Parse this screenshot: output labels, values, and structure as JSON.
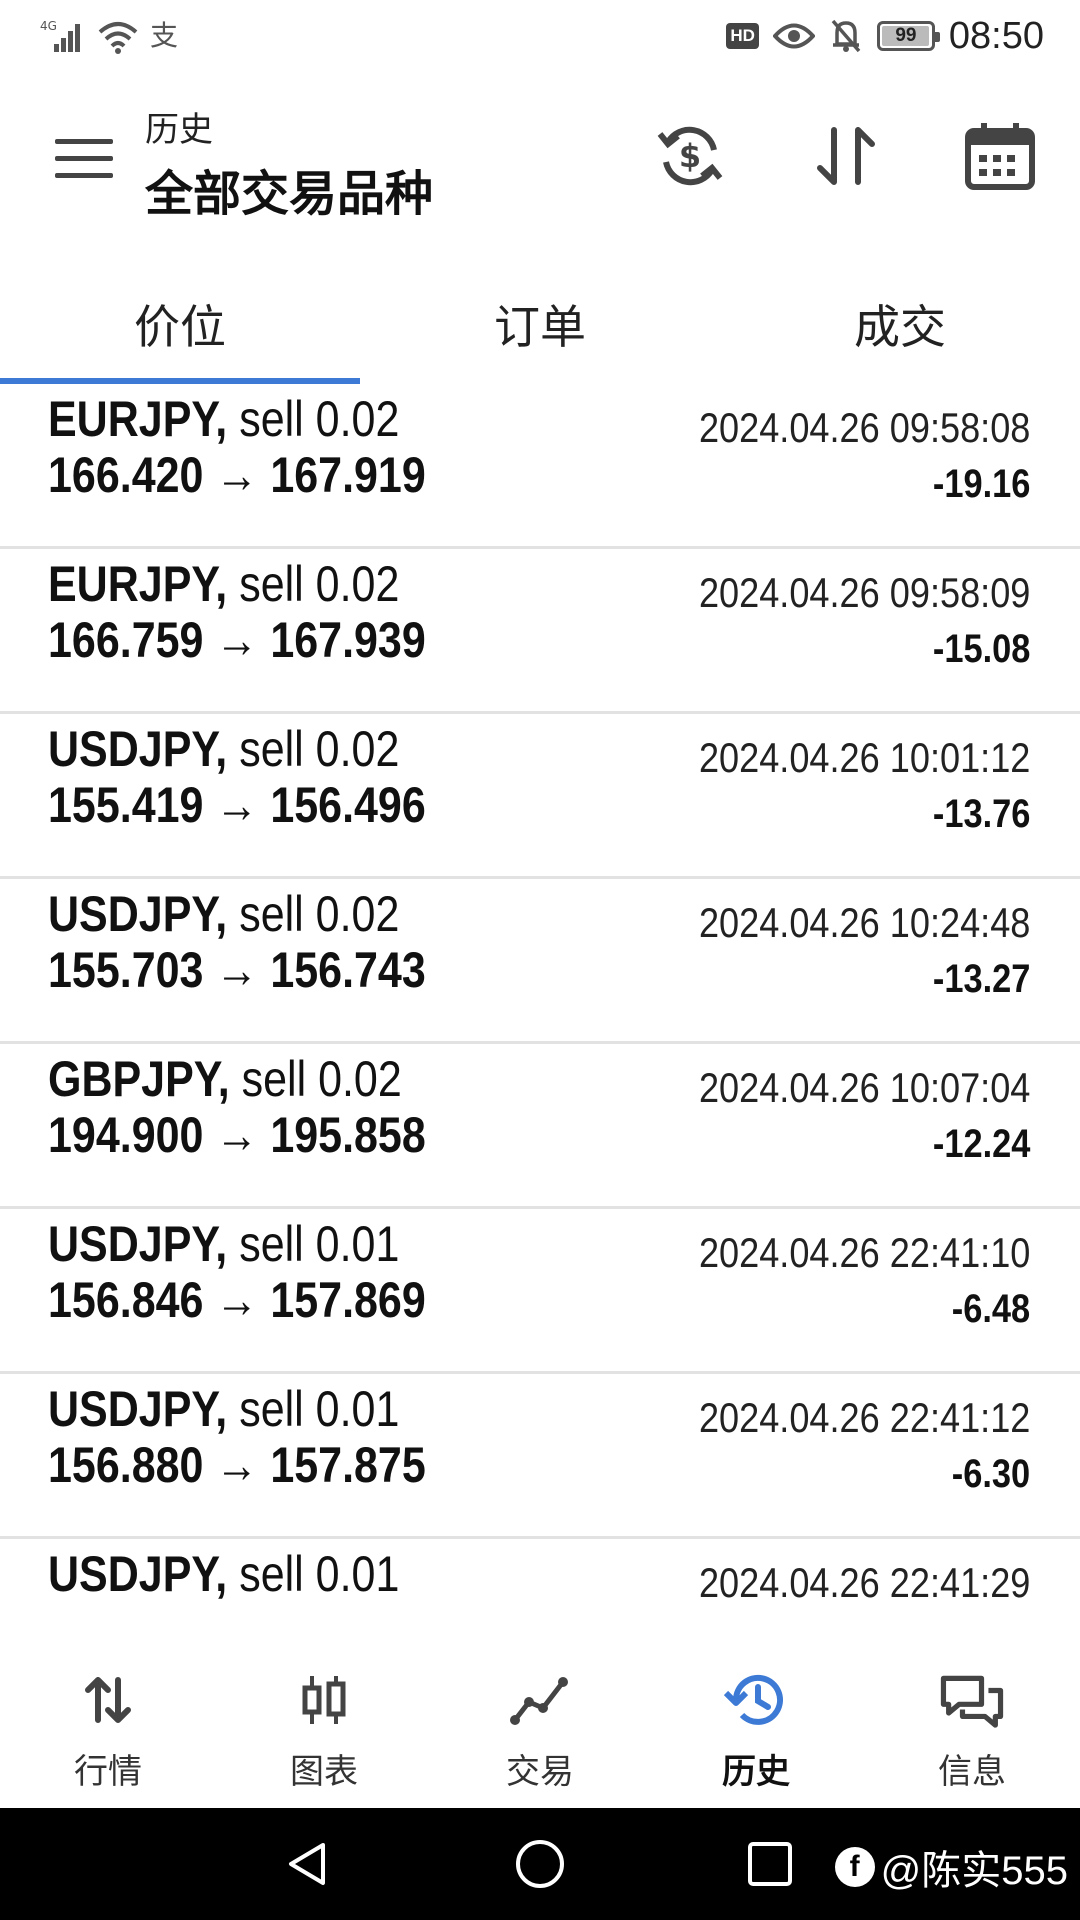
{
  "status_bar": {
    "network_label": "4G",
    "carrier_glyph": "支",
    "hd_label": "HD",
    "battery_level": "99",
    "battery_fraction": 0.99,
    "time": "08:50"
  },
  "header": {
    "subtitle": "历史",
    "title": "全部交易品种"
  },
  "tabs": [
    {
      "label": "价位",
      "selected": true
    },
    {
      "label": "订单",
      "selected": false
    },
    {
      "label": "成交",
      "selected": false
    }
  ],
  "trades": [
    {
      "symbol": "EURJPY,",
      "action": "sell 0.02",
      "prices": "166.420 → 167.919",
      "time": "2024.04.26 09:58:08",
      "profit": "-19.16"
    },
    {
      "symbol": "EURJPY,",
      "action": "sell 0.02",
      "prices": "166.759 → 167.939",
      "time": "2024.04.26 09:58:09",
      "profit": "-15.08"
    },
    {
      "symbol": "USDJPY,",
      "action": "sell 0.02",
      "prices": "155.419 → 156.496",
      "time": "2024.04.26 10:01:12",
      "profit": "-13.76"
    },
    {
      "symbol": "USDJPY,",
      "action": "sell 0.02",
      "prices": "155.703 → 156.743",
      "time": "2024.04.26 10:24:48",
      "profit": "-13.27"
    },
    {
      "symbol": "GBPJPY,",
      "action": "sell 0.02",
      "prices": "194.900 → 195.858",
      "time": "2024.04.26 10:07:04",
      "profit": "-12.24"
    },
    {
      "symbol": "USDJPY,",
      "action": "sell 0.01",
      "prices": "156.846 → 157.869",
      "time": "2024.04.26 22:41:10",
      "profit": "-6.48"
    },
    {
      "symbol": "USDJPY,",
      "action": "sell 0.01",
      "prices": "156.880 → 157.875",
      "time": "2024.04.26 22:41:12",
      "profit": "-6.30"
    },
    {
      "symbol": "USDJPY,",
      "action": "sell 0.01",
      "prices": "",
      "time": "2024.04.26 22:41:29",
      "profit": ""
    }
  ],
  "bottom_nav": [
    {
      "label": "行情",
      "icon": "arrows-updown-icon",
      "active": false
    },
    {
      "label": "图表",
      "icon": "candlestick-icon",
      "active": false
    },
    {
      "label": "交易",
      "icon": "trend-line-icon",
      "active": false
    },
    {
      "label": "历史",
      "icon": "history-clock-icon",
      "active": true
    },
    {
      "label": "信息",
      "icon": "chat-bubbles-icon",
      "active": false
    }
  ],
  "watermark": "@陈实555",
  "colors": {
    "accent": "#3c7ad6",
    "text": "#111111",
    "divider": "#e2e2e2",
    "icon": "#444444"
  }
}
